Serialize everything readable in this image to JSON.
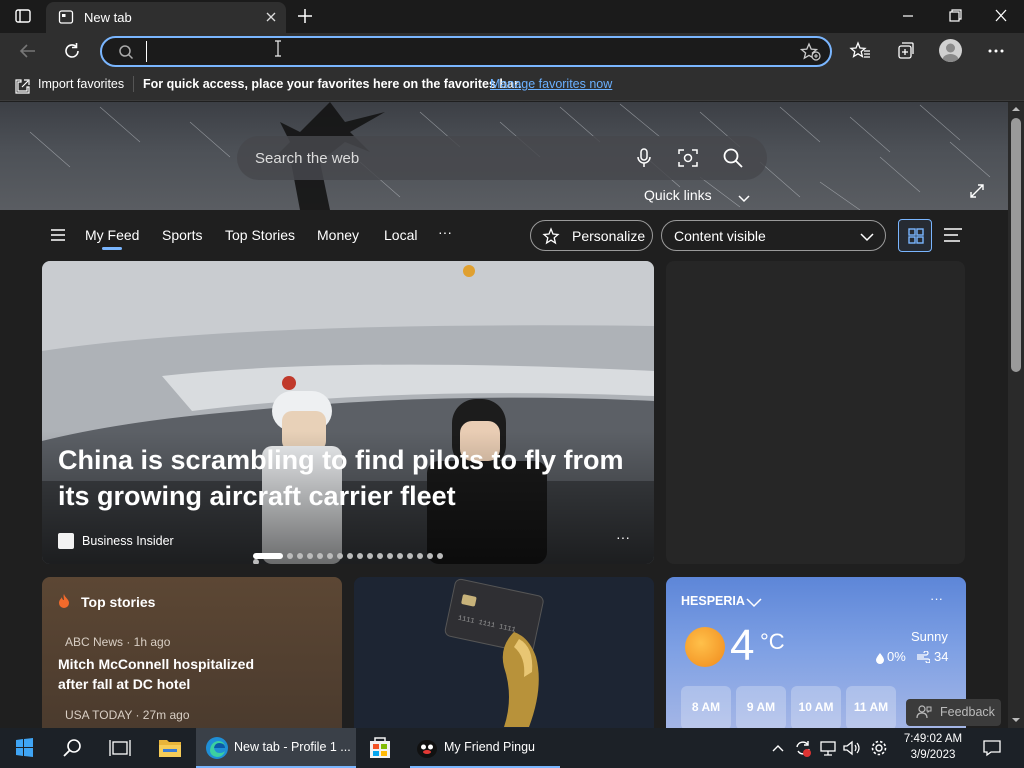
{
  "browser": {
    "tab_title": "New tab",
    "address_value": ""
  },
  "favorites_bar": {
    "import_label": "Import favorites",
    "message": "For quick access, place your favorites here on the favorites bar.",
    "manage_link": "Manage favorites now"
  },
  "hero": {
    "search_placeholder": "Search the web",
    "quick_links": "Quick links"
  },
  "feed_nav": {
    "items": [
      "My Feed",
      "Sports",
      "Top Stories",
      "Money",
      "Local"
    ],
    "more": "···",
    "personalize": "Personalize",
    "content_visible": "Content visible"
  },
  "headline": {
    "title": "China is scrambling to find pilots to fly from its growing aircraft carrier fleet",
    "source": "Business Insider",
    "more": "···",
    "carousel_count": 18,
    "carousel_active": 0
  },
  "top_stories": {
    "heading": "Top stories",
    "items": [
      {
        "meta": "ABC News · 1h ago",
        "title": "Mitch McConnell hospitalized after fall at DC hotel"
      },
      {
        "meta": "USA TODAY · 27m ago"
      }
    ]
  },
  "weather": {
    "location": "HESPERIA",
    "temp": "4",
    "unit": "°C",
    "condition": "Sunny",
    "precip": "0%",
    "wind": "34",
    "more": "···",
    "hours": [
      "8 AM",
      "9 AM",
      "10 AM",
      "11 AM"
    ]
  },
  "feedback": "Feedback",
  "taskbar": {
    "edge_label": "New tab - Profile 1 ...",
    "pingu_label": "My Friend Pingu",
    "time": "7:49:02 AM",
    "date": "3/9/2023"
  },
  "colors": {
    "accent": "#7ab6ff",
    "link": "#6ab0ff",
    "sun": "#f7a23b"
  }
}
